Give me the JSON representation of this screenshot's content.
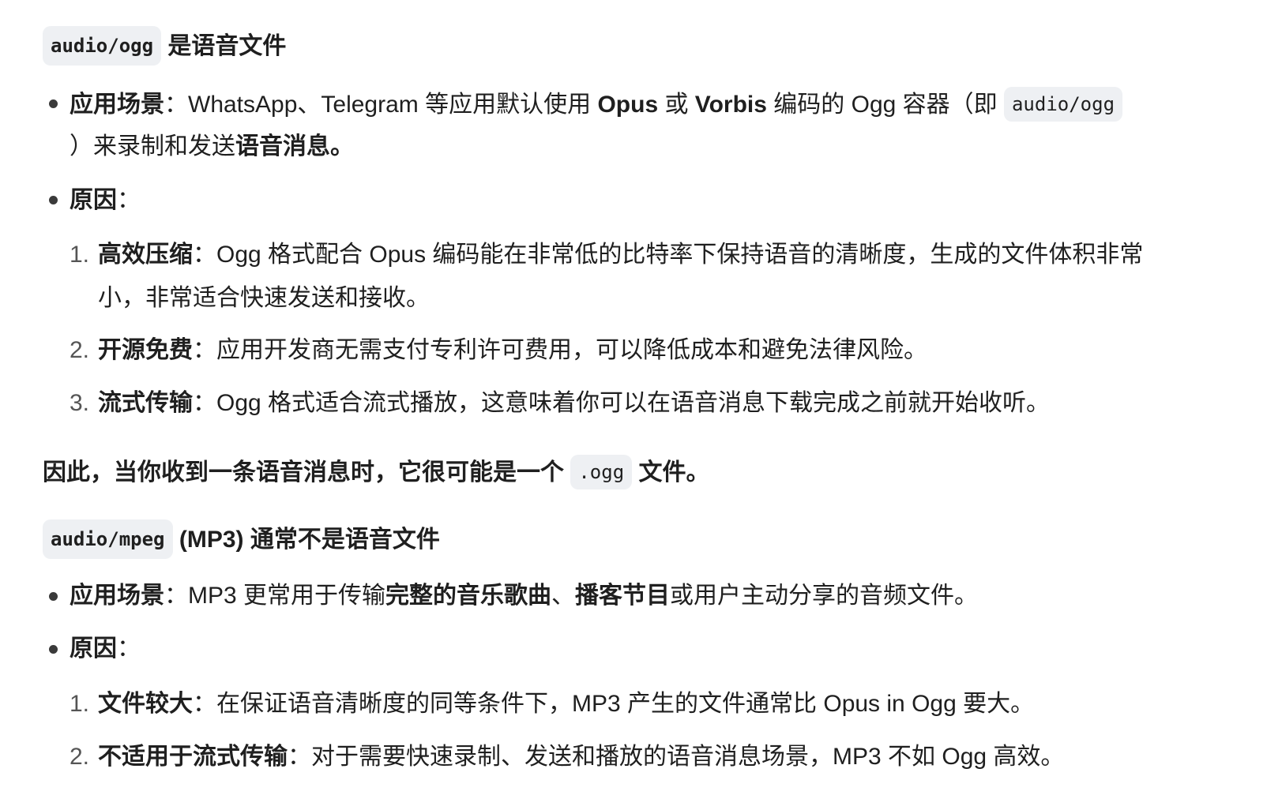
{
  "section1": {
    "heading_code": "audio/ogg",
    "heading_text": "是语音文件",
    "usage": {
      "label": "应用场景",
      "colon": "：",
      "text_a": "WhatsApp、Telegram 等应用默认使用 ",
      "bold_opus": "Opus",
      "text_b": " 或 ",
      "bold_vorbis": "Vorbis",
      "text_c": " 编码的 Ogg 容器（即 ",
      "code": "audio/ogg",
      "line2_a": "）来录制和发送",
      "line2_bold": "语音消息",
      "line2_end": "。"
    },
    "reason_label": "原因",
    "reason_colon": "：",
    "reasons": [
      {
        "num": "1.",
        "label": "高效压缩",
        "colon": "：",
        "text": "Ogg 格式配合 Opus 编码能在非常低的比特率下保持语音的清晰度，生成的文件体积非常",
        "text2": "小，非常适合快速发送和接收。"
      },
      {
        "num": "2.",
        "label": "开源免费",
        "colon": "：",
        "text": "应用开发商无需支付专利许可费用，可以降低成本和避免法律风险。"
      },
      {
        "num": "3.",
        "label": "流式传输",
        "colon": "：",
        "text": "Ogg 格式适合流式播放，这意味着你可以在语音消息下载完成之前就开始收听。"
      }
    ]
  },
  "conclusion": {
    "text_a": "因此，当你收到一条语音消息时，它很可能是一个 ",
    "code": ".ogg",
    "text_b": " 文件。"
  },
  "section2": {
    "heading_code": "audio/mpeg",
    "heading_text": "(MP3) 通常不是语音文件",
    "usage": {
      "label": "应用场景",
      "colon": "：",
      "text_a": "MP3 更常用于传输",
      "bold_a": "完整的音乐歌曲",
      "text_b": "、",
      "bold_b": "播客节目",
      "text_c": "或用户主动分享的音频文件。"
    },
    "reason_label": "原因",
    "reason_colon": "：",
    "reasons": [
      {
        "num": "1.",
        "label": "文件较大",
        "colon": "：",
        "text": "在保证语音清晰度的同等条件下，MP3 产生的文件通常比 Opus in Ogg 要大。"
      },
      {
        "num": "2.",
        "label": "不适用于流式传输",
        "colon": "：",
        "text": "对于需要快速录制、发送和播放的语音消息场景，MP3 不如 Ogg 高效。"
      }
    ]
  }
}
